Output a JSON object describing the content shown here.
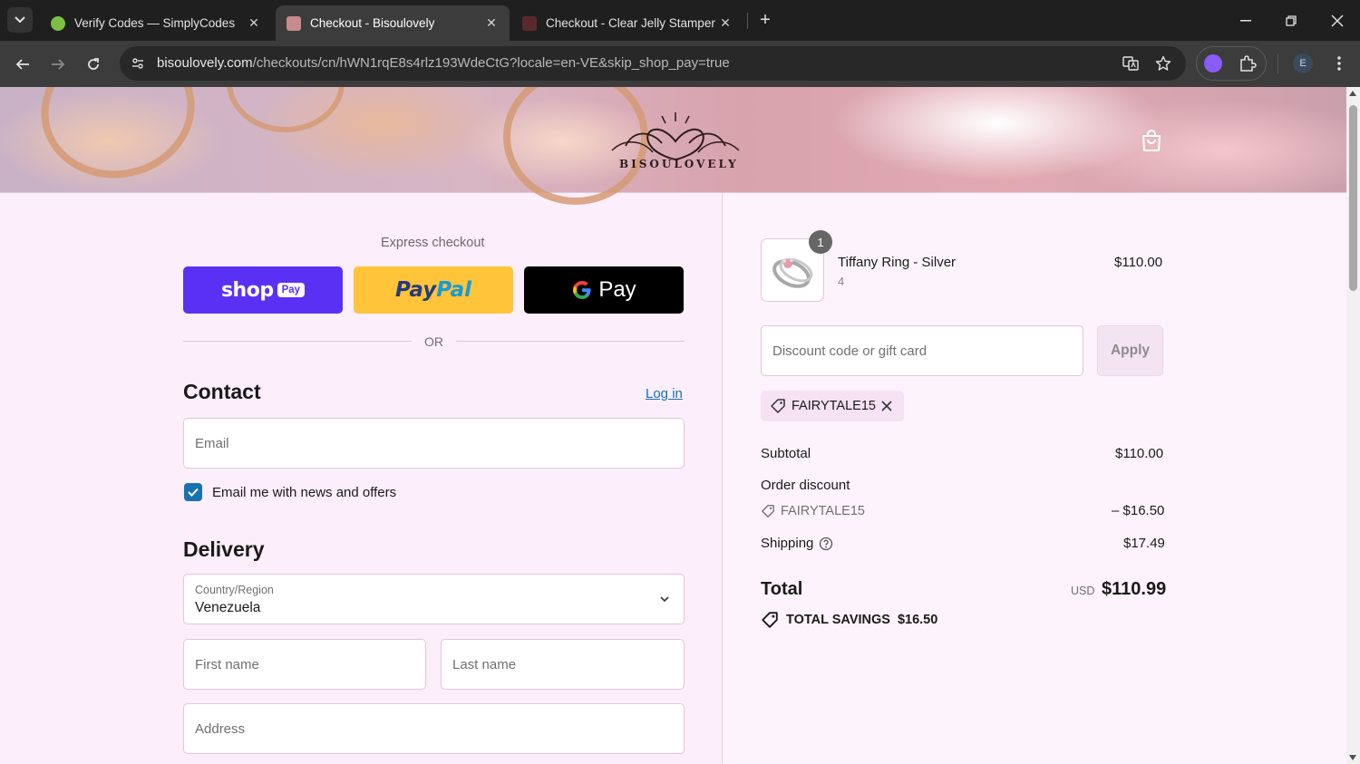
{
  "browser": {
    "tabs": [
      {
        "title": "Verify Codes — SimplyCodes",
        "active": false
      },
      {
        "title": "Checkout - Bisoulovely",
        "active": true
      },
      {
        "title": "Checkout - Clear Jelly Stamper",
        "active": false
      }
    ],
    "url_host": "bisoulovely.com",
    "url_path": "/checkouts/cn/hWN1rqE8s4rlz193WdeCtG?locale=en-VE&skip_shop_pay=true",
    "profile_initial": "E"
  },
  "store": {
    "logo_text": "BISOULOVELY"
  },
  "checkout": {
    "express_label": "Express checkout",
    "shop_pay_word": "shop",
    "shop_pay_badge": "Pay",
    "paypal_pay": "Pay",
    "paypal_pal": "Pal",
    "gpay_word": "Pay",
    "or_label": "OR",
    "contact_heading": "Contact",
    "login_link": "Log in",
    "email_placeholder": "Email",
    "news_label": "Email me with news and offers",
    "news_checked": true,
    "delivery_heading": "Delivery",
    "country_label": "Country/Region",
    "country_value": "Venezuela",
    "first_name_placeholder": "First name",
    "last_name_placeholder": "Last name",
    "address_placeholder": "Address"
  },
  "summary": {
    "item": {
      "name": "Tiffany Ring - Silver",
      "variant": "4",
      "price": "$110.00",
      "quantity": "1"
    },
    "discount_placeholder": "Discount code or gift card",
    "apply_label": "Apply",
    "applied_code": "FAIRYTALE15",
    "subtotal_label": "Subtotal",
    "subtotal_value": "$110.00",
    "order_discount_label": "Order discount",
    "order_discount_code": "FAIRYTALE15",
    "order_discount_value": "– $16.50",
    "shipping_label": "Shipping",
    "shipping_value": "$17.49",
    "total_label": "Total",
    "currency": "USD",
    "total_value": "$110.99",
    "savings_label": "TOTAL SAVINGS",
    "savings_value": "$16.50"
  },
  "colors": {
    "shop_pay": "#5a31f4",
    "paypal": "#ffc439",
    "gpay": "#000000",
    "link": "#1773b0",
    "page_bg": "#fceefb"
  }
}
